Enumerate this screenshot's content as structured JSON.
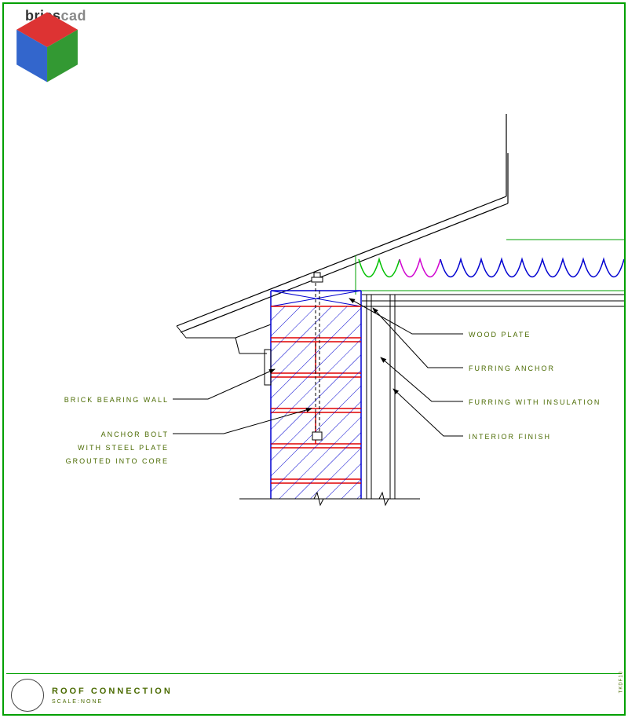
{
  "brand": {
    "part1": "brics",
    "part2": "cad"
  },
  "title": {
    "main": "ROOF CONNECTION",
    "scale": "SCALE:NONE"
  },
  "annotations": {
    "wood_plate": "WOOD PLATE",
    "furring_anchor": "FURRING ANCHOR",
    "furring_insulation": "FURRING WITH INSULATION",
    "interior_finish": "INTERIOR FINISH",
    "brick_wall": "BRICK BEARING WALL",
    "anchor_bolt_l1": "ANCHOR BOLT",
    "anchor_bolt_l2": "WITH STEEL PLATE",
    "anchor_bolt_l3": "GROUTED INTO CORE"
  },
  "side_label": "TKDF10"
}
